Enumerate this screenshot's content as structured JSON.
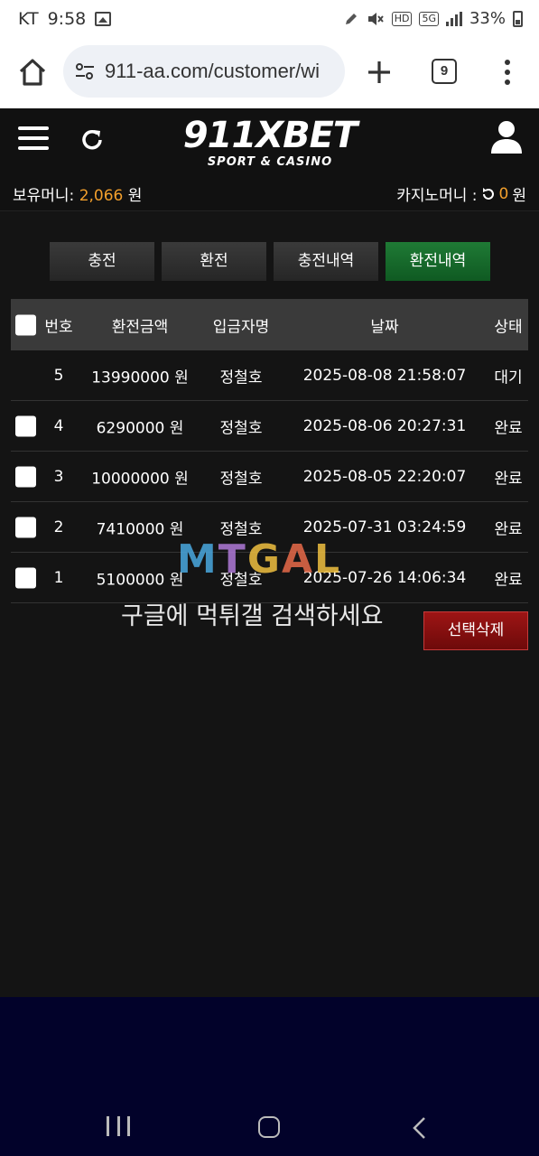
{
  "status_bar": {
    "carrier": "KT",
    "time": "9:58",
    "network_hd": "HD",
    "network_5g": "5G",
    "battery": "33%"
  },
  "browser": {
    "url": "911-aa.com/customer/wi",
    "tab_count": "9"
  },
  "site": {
    "logo_text": "911XBET",
    "logo_sub": "SPORT & CASINO"
  },
  "balance": {
    "money_label": "보유머니: ",
    "money_value": "2,066",
    "money_unit": " 원",
    "casino_label": "카지노머니 : ",
    "casino_value": "0",
    "casino_unit": " 원"
  },
  "tabs": [
    {
      "label": "충전",
      "active": false
    },
    {
      "label": "환전",
      "active": false
    },
    {
      "label": "충전내역",
      "active": false
    },
    {
      "label": "환전내역",
      "active": true
    }
  ],
  "table": {
    "headers": [
      "번호",
      "환전금액",
      "입금자명",
      "날짜",
      "상태"
    ],
    "rows": [
      {
        "no": "5",
        "amount": "13990000 원",
        "name": "정철호",
        "date": "2025-08-08 21:58:07",
        "status": "대기",
        "checkbox": false
      },
      {
        "no": "4",
        "amount": "6290000 원",
        "name": "정철호",
        "date": "2025-08-06 20:27:31",
        "status": "완료",
        "checkbox": true
      },
      {
        "no": "3",
        "amount": "10000000 원",
        "name": "정철호",
        "date": "2025-08-05 22:20:07",
        "status": "완료",
        "checkbox": true
      },
      {
        "no": "2",
        "amount": "7410000 원",
        "name": "정철호",
        "date": "2025-07-31 03:24:59",
        "status": "완료",
        "checkbox": true
      },
      {
        "no": "1",
        "amount": "5100000 원",
        "name": "정철호",
        "date": "2025-07-26 14:06:34",
        "status": "완료",
        "checkbox": true
      }
    ]
  },
  "delete_button": "선택삭제",
  "watermark": {
    "logo": "MTGAL",
    "text": "구글에 먹튀갤 검색하세요"
  },
  "colors": {
    "accent_orange": "#f29f2c",
    "tab_active_green": "#1f7a35",
    "delete_red": "#9e1515"
  }
}
